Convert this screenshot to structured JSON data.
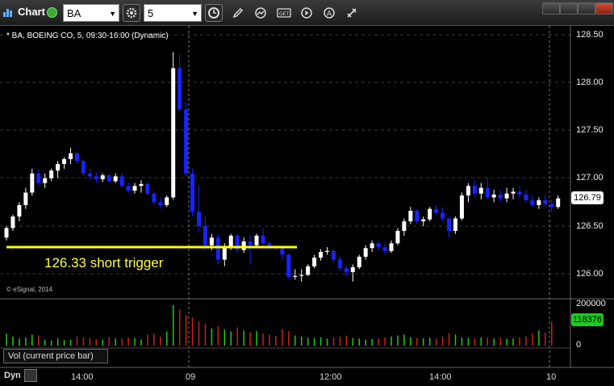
{
  "window": {
    "title": "Chart",
    "symbol": "BA",
    "interval": "5"
  },
  "chart_info": {
    "description": "* BA, BOEING CO, 5, 09:30-16:00 (Dynamic)",
    "copyright": "© eSignal, 2014",
    "annotation": "126.33 short trigger"
  },
  "price_axis": {
    "labels": [
      "128.50",
      "128.00",
      "127.50",
      "127.00",
      "126.50",
      "126.00"
    ],
    "last_price": "126.79"
  },
  "volume_axis": {
    "labels": [
      "200000",
      "0"
    ],
    "last_volume": "118376",
    "legend": "Vol (current price bar)"
  },
  "time_axis": {
    "labels": [
      "14:00",
      "09",
      "12:00",
      "14:00",
      "10"
    ]
  },
  "bottom": {
    "mode": "Dyn"
  },
  "colors": {
    "up_candle": "#ffffff",
    "down_candle": "#1a22ff",
    "trigger_line": "#ffff00",
    "vol_up": "#22c822",
    "vol_down": "#c82222",
    "background": "#000000"
  },
  "chart_data": {
    "type": "candlestick",
    "price_range": [
      125.85,
      128.6
    ],
    "trigger_level": 126.33,
    "candles": [
      [
        126.38,
        126.5,
        126.35,
        126.48
      ],
      [
        126.48,
        126.62,
        126.45,
        126.6
      ],
      [
        126.6,
        126.75,
        126.55,
        126.72
      ],
      [
        126.72,
        126.9,
        126.68,
        126.85
      ],
      [
        126.85,
        127.1,
        126.82,
        127.05
      ],
      [
        127.05,
        127.1,
        126.92,
        126.95
      ],
      [
        126.95,
        127.05,
        126.9,
        127.0
      ],
      [
        127.0,
        127.1,
        126.97,
        127.08
      ],
      [
        127.08,
        127.18,
        127.0,
        127.15
      ],
      [
        127.15,
        127.22,
        127.1,
        127.2
      ],
      [
        127.2,
        127.32,
        127.15,
        127.26
      ],
      [
        127.26,
        127.28,
        127.15,
        127.18
      ],
      [
        127.18,
        127.2,
        127.02,
        127.05
      ],
      [
        127.05,
        127.1,
        126.98,
        127.02
      ],
      [
        127.02,
        127.06,
        126.95,
        126.99
      ],
      [
        126.99,
        127.05,
        126.96,
        127.03
      ],
      [
        127.03,
        127.05,
        126.95,
        126.97
      ],
      [
        126.97,
        127.05,
        126.95,
        127.02
      ],
      [
        127.02,
        127.05,
        126.9,
        126.92
      ],
      [
        126.92,
        126.96,
        126.85,
        126.87
      ],
      [
        126.87,
        126.95,
        126.84,
        126.92
      ],
      [
        126.92,
        126.98,
        126.85,
        126.94
      ],
      [
        126.94,
        126.96,
        126.82,
        126.84
      ],
      [
        126.84,
        126.86,
        126.72,
        126.75
      ],
      [
        126.75,
        126.8,
        126.68,
        126.72
      ],
      [
        126.72,
        126.82,
        126.7,
        126.8
      ],
      [
        126.8,
        128.32,
        126.78,
        128.15
      ],
      [
        128.15,
        128.3,
        127.7,
        127.72
      ],
      [
        127.72,
        127.8,
        127.02,
        127.05
      ],
      [
        127.05,
        127.1,
        126.6,
        126.65
      ],
      [
        126.65,
        126.92,
        126.45,
        126.5
      ],
      [
        126.5,
        126.6,
        126.25,
        126.3
      ],
      [
        126.3,
        126.42,
        126.25,
        126.38
      ],
      [
        126.38,
        126.42,
        126.1,
        126.15
      ],
      [
        126.15,
        126.32,
        126.08,
        126.28
      ],
      [
        126.28,
        126.42,
        126.25,
        126.4
      ],
      [
        126.4,
        126.42,
        126.22,
        126.25
      ],
      [
        126.25,
        126.38,
        126.22,
        126.34
      ],
      [
        126.34,
        126.4,
        126.1,
        126.3
      ],
      [
        126.3,
        126.42,
        126.28,
        126.4
      ],
      [
        126.4,
        126.48,
        126.3,
        126.32
      ],
      [
        126.32,
        126.35,
        126.25,
        126.28
      ],
      [
        126.28,
        126.3,
        126.25,
        126.27
      ],
      [
        126.27,
        126.3,
        126.15,
        126.2
      ],
      [
        126.2,
        126.22,
        125.95,
        125.97
      ],
      [
        125.97,
        126.05,
        125.94,
        125.98
      ],
      [
        125.98,
        126.05,
        125.92,
        125.99
      ],
      [
        125.99,
        126.1,
        125.98,
        126.08
      ],
      [
        126.08,
        126.2,
        126.06,
        126.17
      ],
      [
        126.17,
        126.26,
        126.14,
        126.23
      ],
      [
        126.23,
        126.28,
        126.2,
        126.24
      ],
      [
        126.24,
        126.26,
        126.12,
        126.15
      ],
      [
        126.15,
        126.18,
        126.03,
        126.06
      ],
      [
        126.06,
        126.08,
        125.98,
        126.02
      ],
      [
        126.02,
        126.1,
        125.92,
        126.07
      ],
      [
        126.07,
        126.2,
        126.05,
        126.18
      ],
      [
        126.18,
        126.3,
        126.15,
        126.27
      ],
      [
        126.27,
        126.35,
        126.23,
        126.32
      ],
      [
        126.32,
        126.35,
        126.25,
        126.28
      ],
      [
        126.28,
        126.32,
        126.2,
        126.24
      ],
      [
        126.24,
        126.35,
        126.22,
        126.32
      ],
      [
        126.32,
        126.48,
        126.3,
        126.45
      ],
      [
        126.45,
        126.58,
        126.4,
        126.55
      ],
      [
        126.55,
        126.7,
        126.52,
        126.66
      ],
      [
        126.66,
        126.68,
        126.52,
        126.55
      ],
      [
        126.55,
        126.6,
        126.5,
        126.57
      ],
      [
        126.57,
        126.7,
        126.55,
        126.68
      ],
      [
        126.68,
        126.72,
        126.62,
        126.64
      ],
      [
        126.64,
        126.7,
        126.55,
        126.58
      ],
      [
        126.58,
        126.6,
        126.38,
        126.45
      ],
      [
        126.45,
        126.6,
        126.42,
        126.58
      ],
      [
        126.58,
        126.85,
        126.56,
        126.82
      ],
      [
        126.82,
        126.95,
        126.75,
        126.92
      ],
      [
        126.92,
        126.98,
        126.8,
        126.84
      ],
      [
        126.84,
        126.95,
        126.78,
        126.9
      ],
      [
        126.9,
        127.0,
        126.78,
        126.8
      ],
      [
        126.8,
        126.88,
        126.75,
        126.83
      ],
      [
        126.83,
        126.88,
        126.75,
        126.79
      ],
      [
        126.79,
        126.9,
        126.75,
        126.84
      ],
      [
        126.84,
        126.9,
        126.78,
        126.86
      ],
      [
        126.86,
        126.92,
        126.8,
        126.83
      ],
      [
        126.83,
        126.88,
        126.75,
        126.77
      ],
      [
        126.77,
        126.82,
        126.7,
        126.72
      ],
      [
        126.72,
        126.8,
        126.68,
        126.77
      ],
      [
        126.77,
        126.82,
        126.7,
        126.73
      ],
      [
        126.73,
        126.78,
        126.65,
        126.7
      ],
      [
        126.7,
        126.82,
        126.68,
        126.79
      ]
    ],
    "volumes": [
      60000,
      45000,
      35000,
      40000,
      55000,
      50000,
      30000,
      25000,
      35000,
      28000,
      30000,
      45000,
      40000,
      38000,
      32000,
      30000,
      42000,
      36000,
      35000,
      40000,
      38000,
      30000,
      55000,
      60000,
      45000,
      70000,
      200000,
      180000,
      150000,
      140000,
      120000,
      110000,
      85000,
      95000,
      80000,
      70000,
      90000,
      75000,
      65000,
      72000,
      60000,
      55000,
      48000,
      82000,
      70000,
      50000,
      45000,
      40000,
      38000,
      42000,
      35000,
      40000,
      45000,
      50000,
      38000,
      35000,
      30000,
      32000,
      36000,
      40000,
      45000,
      50000,
      55000,
      42000,
      38000,
      36000,
      40000,
      35000,
      45000,
      60000,
      55000,
      40000,
      38000,
      36000,
      42000,
      40000,
      35000,
      38000,
      34000,
      36000,
      40000,
      45000,
      60000,
      75000,
      65000,
      118376
    ]
  }
}
